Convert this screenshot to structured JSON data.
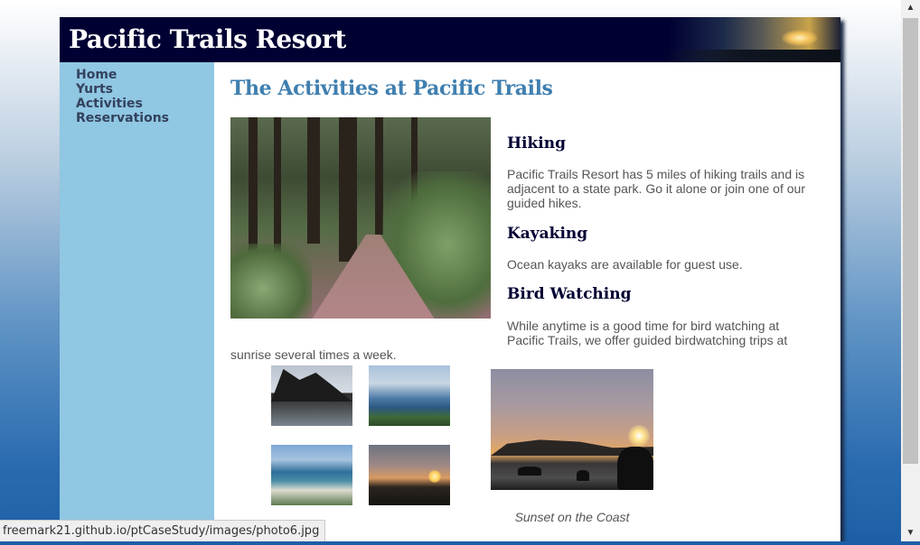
{
  "header": {
    "title": "Pacific Trails Resort"
  },
  "nav": {
    "items": [
      {
        "label": "Home"
      },
      {
        "label": "Yurts"
      },
      {
        "label": "Activities"
      },
      {
        "label": "Reservations"
      }
    ]
  },
  "main": {
    "heading": "The Activities at Pacific Trails",
    "sections": [
      {
        "title": "Hiking",
        "text": "Pacific Trails Resort has 5 miles of hiking trails and is adjacent to a state park. Go it alone or join one of our guided hikes."
      },
      {
        "title": "Kayaking",
        "text": "Ocean kayaks are available for guest use."
      },
      {
        "title": "Bird Watching",
        "text_line1": "While anytime is a good time for bird watching at",
        "text_line2": "Pacific Trails, we offer guided birdwatching trips at",
        "text_line3": "sunrise several times a week."
      }
    ],
    "gallery": {
      "caption": "Sunset on the Coast"
    }
  },
  "statusbar": {
    "url": "freemark21.github.io/ptCaseStudy/images/photo6.jpg"
  },
  "scrollbar": {
    "up": "▲",
    "down": "▼"
  }
}
